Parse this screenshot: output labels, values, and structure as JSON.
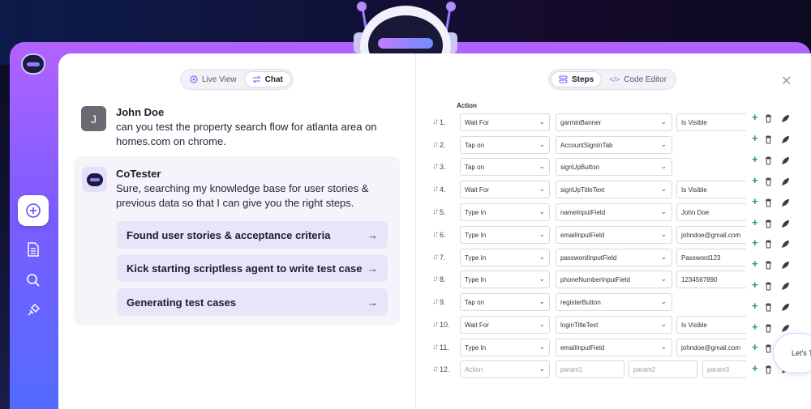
{
  "header": {
    "live_view_label": "Live View",
    "chat_label": "Chat",
    "steps_label": "Steps",
    "code_editor_label": "Code Editor"
  },
  "chat": {
    "user": {
      "initial": "J",
      "name": "John Doe",
      "message_line1": "can you test the property search flow for atlanta area on",
      "message_line2": "homes.com on chrome."
    },
    "bot": {
      "name": "CoTester",
      "message_line1": "Sure, searching my knowledge base for user stories &",
      "message_line2": "previous data so that I can give you the right steps.",
      "steps": [
        "Found user stories & acceptance criteria",
        "Kick starting scriptless agent to write test case",
        "Generating test cases"
      ]
    }
  },
  "steps_table": {
    "action_header": "Action",
    "rows": [
      {
        "num": "1.",
        "action": "Wait For",
        "element": "garminBanner",
        "value": "Is Visible"
      },
      {
        "num": "2.",
        "action": "Tap on",
        "element": "AccountSignInTab",
        "value": ""
      },
      {
        "num": "3.",
        "action": "Tap on",
        "element": "signUpButton",
        "value": ""
      },
      {
        "num": "4.",
        "action": "Wait For",
        "element": "signUpTitleText",
        "value": "Is Visible"
      },
      {
        "num": "5.",
        "action": "Type In",
        "element": "nameInputField",
        "value": "John Doe"
      },
      {
        "num": "6.",
        "action": "Type In",
        "element": "emailInputField",
        "value": "johndoe@gmail.com"
      },
      {
        "num": "7.",
        "action": "Type In",
        "element": "passwordInputField",
        "value": "Password123"
      },
      {
        "num": "8.",
        "action": "Type In",
        "element": "phoneNumberInputField",
        "value": "1234567890"
      },
      {
        "num": "9.",
        "action": "Tap on",
        "element": "registerButton",
        "value": ""
      },
      {
        "num": "10.",
        "action": "Wait For",
        "element": "loginTitleText",
        "value": "Is Visible"
      },
      {
        "num": "11.",
        "action": "Type In",
        "element": "emailInputField",
        "value": "johndoe@gmail.com"
      }
    ],
    "new_row": {
      "num": "12.",
      "action_placeholder": "Action",
      "param1": "param1",
      "param2": "param2",
      "param3": "param3"
    }
  },
  "chat_bubble_text": "Let's T",
  "colors": {
    "accent_purple": "#7b5cff",
    "add_green": "#2e9e4a"
  }
}
